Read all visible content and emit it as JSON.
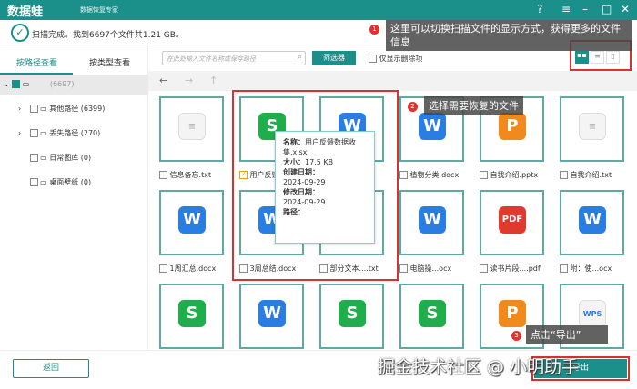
{
  "app": {
    "name": "数据蛙",
    "subtitle": "数据恢复专家",
    "colors": {
      "brand": "#1b8f8a",
      "highlight": "#d93030"
    }
  },
  "window_controls": [
    "help-icon",
    "menu-icon",
    "minimize-icon",
    "maximize-icon",
    "close-icon"
  ],
  "status": "扫描完成。找到6697个文件共1.21 GB。",
  "sidebar": {
    "tabs": [
      "按路径查看",
      "按类型查看"
    ],
    "root_count": "(6697)",
    "items": [
      {
        "label": "其他路径 (6399)"
      },
      {
        "label": "丢失路径 (270)"
      },
      {
        "label": "日常图库 (0)"
      },
      {
        "label": "桌面壁纸 (0)"
      }
    ]
  },
  "toolbar": {
    "search_placeholder": "在此处输入文件名称或保存路径",
    "filter": "筛选器",
    "only_deleted": "仅显示删除项"
  },
  "files": [
    {
      "name": "信息备忘.txt",
      "icon": "txt",
      "checked": false
    },
    {
      "name": "用户反馈...",
      "icon": "S",
      "checked": true
    },
    {
      "name": "...ocx",
      "icon": "W",
      "checked": false
    },
    {
      "name": "植物分类.docx",
      "icon": "W",
      "checked": false
    },
    {
      "name": "自我介绍.pptx",
      "icon": "P",
      "checked": false
    },
    {
      "name": "自我介绍.txt",
      "icon": "txt",
      "checked": false
    },
    {
      "name": "1周汇总.docx",
      "icon": "W",
      "checked": false
    },
    {
      "name": "3周总结.docx",
      "icon": "W",
      "checked": false
    },
    {
      "name": "部分文本....txt",
      "icon": "",
      "checked": false
    },
    {
      "name": "电脑操...ocx",
      "icon": "W",
      "checked": false
    },
    {
      "name": "读书片段....pdf",
      "icon": "PDF",
      "checked": false
    },
    {
      "name": "附：使...ocx",
      "icon": "W",
      "checked": false
    },
    {
      "name": "",
      "icon": "S"
    },
    {
      "name": "",
      "icon": "W"
    },
    {
      "name": "",
      "icon": "S"
    },
    {
      "name": "",
      "icon": "S"
    },
    {
      "name": "",
      "icon": "P"
    },
    {
      "name": "",
      "icon": "WPS"
    }
  ],
  "tooltip": {
    "name_label": "名称：",
    "name": "用户反馈数据收集.xlsx",
    "size_label": "大小：",
    "size": "17.5 KB",
    "created_label": "创建日期：",
    "created": "2024-09-29",
    "modified_label": "修改日期：",
    "modified": "2024-09-29",
    "path_label": "路径："
  },
  "callouts": {
    "c1": "这里可以切换扫描文件的显示方式，获得更多的文件信息",
    "c2": "选择需要恢复的文件",
    "c3": "点击“导出”",
    "n1": "1",
    "n2": "2",
    "n3": "3"
  },
  "footer": {
    "back": "返回",
    "export": "导出",
    "watermark": "掘金技术社区 @ 小明助手"
  }
}
